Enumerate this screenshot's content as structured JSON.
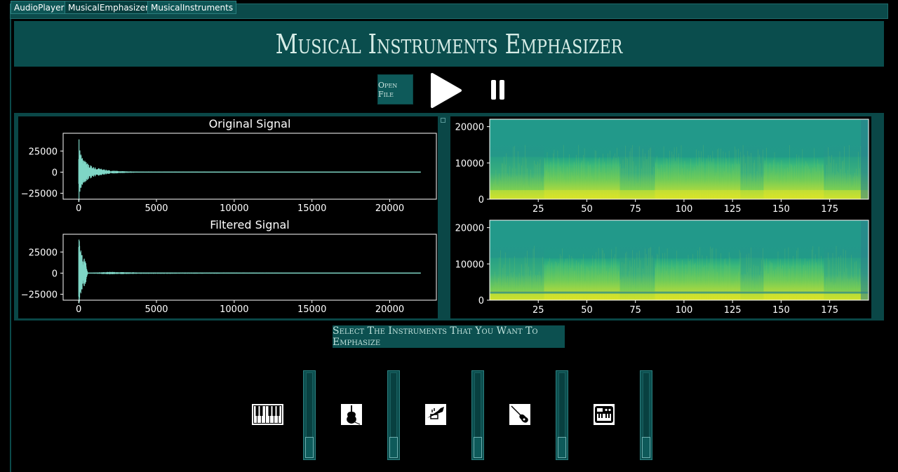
{
  "tabs": [
    {
      "label": "AudioPlayer"
    },
    {
      "label": "MusicalEmphasizer"
    },
    {
      "label": "MusicalInstruments"
    }
  ],
  "header": {
    "title": "Musical Instruments Emphasizer"
  },
  "controls": {
    "open_file_label": "Open File",
    "play_icon": "play-icon",
    "pause_icon": "pause-icon"
  },
  "instruments_prompt": "Select The Instruments That You Want To Emphasize",
  "instruments": [
    {
      "icon": "piano-icon",
      "level": 0
    },
    {
      "icon": "cello-icon",
      "level": 0
    },
    {
      "icon": "trumpet-icon",
      "level": 0
    },
    {
      "icon": "guitar-icon",
      "level": 0
    },
    {
      "icon": "synthesizer-icon",
      "level": 0
    }
  ],
  "colors": {
    "accent": "#0a4d4d",
    "signal": "#7fd6c6",
    "background": "#000000"
  },
  "chart_data": [
    {
      "type": "line",
      "title": "Original Signal",
      "xlabel": "",
      "ylabel": "",
      "xlim": [
        -1000,
        23000
      ],
      "ylim": [
        -32000,
        46000
      ],
      "xticks": [
        0,
        5000,
        10000,
        15000,
        20000
      ],
      "xtick_labels": [
        "0",
        "5000",
        "10000",
        "15000",
        "20000"
      ],
      "yticks": [
        25000,
        0,
        -25000
      ],
      "ytick_labels": [
        "25000",
        "0",
        "−25000"
      ],
      "envelope": {
        "x": [
          0,
          100,
          200,
          400,
          600,
          1000,
          1500,
          2000,
          3000,
          4000,
          16000,
          22000
        ],
        "amplitude": [
          44000,
          28000,
          20000,
          14000,
          10000,
          6000,
          4000,
          2000,
          1000,
          500,
          300,
          0
        ]
      }
    },
    {
      "type": "line",
      "title": "Filtered Signal",
      "xlabel": "",
      "ylabel": "",
      "xlim": [
        -1000,
        23000
      ],
      "ylim": [
        -32000,
        46000
      ],
      "xticks": [
        0,
        5000,
        10000,
        15000,
        20000
      ],
      "xtick_labels": [
        "0",
        "5000",
        "10000",
        "15000",
        "20000"
      ],
      "yticks": [
        25000,
        0,
        -25000
      ],
      "ytick_labels": [
        "25000",
        "0",
        "−25000"
      ],
      "envelope": {
        "x": [
          0,
          100,
          200,
          400,
          500,
          600,
          2000,
          4000,
          16000,
          22000
        ],
        "amplitude": [
          44000,
          30000,
          22000,
          18000,
          8000,
          300,
          1500,
          800,
          300,
          0
        ]
      }
    },
    {
      "type": "heatmap",
      "title": "",
      "xlim": [
        0,
        195
      ],
      "ylim": [
        0,
        22050
      ],
      "xticks": [
        25,
        50,
        75,
        100,
        125,
        150,
        175
      ],
      "xtick_labels": [
        "25",
        "50",
        "75",
        "100",
        "125",
        "150",
        "175"
      ],
      "yticks": [
        0,
        10000,
        20000
      ],
      "ytick_labels": [
        "0",
        "10000",
        "20000"
      ],
      "loud_segments": [
        [
          28,
          67
        ],
        [
          85,
          129
        ],
        [
          141,
          172
        ]
      ]
    },
    {
      "type": "heatmap",
      "title": "",
      "xlim": [
        0,
        195
      ],
      "ylim": [
        0,
        22050
      ],
      "xticks": [
        25,
        50,
        75,
        100,
        125,
        150,
        175
      ],
      "xtick_labels": [
        "25",
        "50",
        "75",
        "100",
        "125",
        "150",
        "175"
      ],
      "yticks": [
        0,
        10000,
        20000
      ],
      "ytick_labels": [
        "0",
        "10000",
        "20000"
      ],
      "loud_segments": [
        [
          28,
          67
        ],
        [
          85,
          129
        ],
        [
          141,
          172
        ]
      ]
    }
  ]
}
